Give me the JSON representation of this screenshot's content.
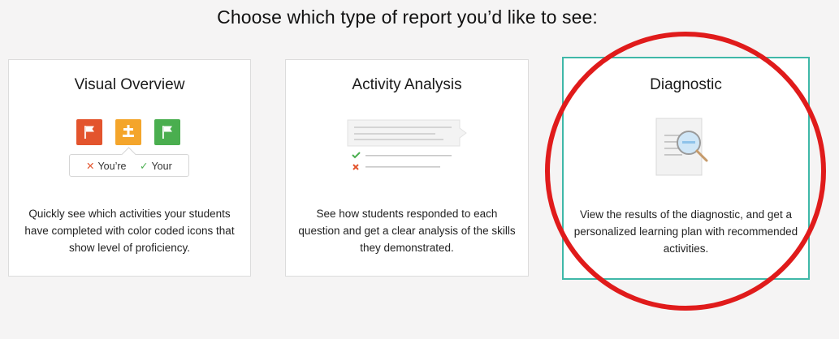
{
  "header": {
    "title": "Choose which type of report you’d like to see:"
  },
  "cards": [
    {
      "title": "Visual Overview",
      "description": "Quickly see which activities your students have completed with color coded icons that show level of proficiency.",
      "legend": {
        "wrong_label": "You’re",
        "right_label": "Your"
      },
      "icon_colors": [
        "#e3542d",
        "#f4a52b",
        "#4aae4f"
      ]
    },
    {
      "title": "Activity Analysis",
      "description": "See how students responded to each question and get a clear analysis of the skills they demonstrated."
    },
    {
      "title": "Diagnostic",
      "description": "View the results of the diagnostic, and get a personalized learning plan with recommended activities.",
      "selected": true
    }
  ],
  "colors": {
    "selected_border": "#3fb8a8",
    "annotation_circle": "#e01b1b",
    "check": "#4aae4f",
    "cross": "#e3542d"
  }
}
